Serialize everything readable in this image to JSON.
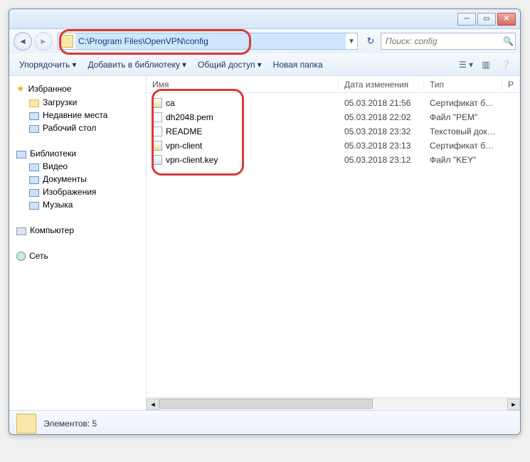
{
  "address_bar": {
    "path": "C:\\Program Files\\OpenVPN\\config"
  },
  "search": {
    "placeholder": "Поиск: config"
  },
  "toolbar": {
    "organize": "Упорядочить",
    "library": "Добавить в библиотеку",
    "share": "Общий доступ",
    "new_folder": "Новая папка"
  },
  "sidebar": {
    "favorites": {
      "title": "Избранное",
      "items": [
        "Загрузки",
        "Недавние места",
        "Рабочий стол"
      ]
    },
    "libraries": {
      "title": "Библиотеки",
      "items": [
        "Видео",
        "Документы",
        "Изображения",
        "Музыка"
      ]
    },
    "computer": {
      "title": "Компьютер"
    },
    "network": {
      "title": "Сеть"
    }
  },
  "columns": {
    "name": "Имя",
    "date": "Дата изменения",
    "type": "Тип",
    "size": "Р"
  },
  "files": [
    {
      "name": "ca",
      "date": "05.03.2018 21:56",
      "type": "Сертификат безо…",
      "icon": "cert"
    },
    {
      "name": "dh2048.pem",
      "date": "05.03.2018 22:02",
      "type": "Файл \"PEM\"",
      "icon": "file"
    },
    {
      "name": "README",
      "date": "05.03.2018 23:32",
      "type": "Текстовый докум…",
      "icon": "file"
    },
    {
      "name": "vpn-client",
      "date": "05.03.2018 23:13",
      "type": "Сертификат безо…",
      "icon": "cert"
    },
    {
      "name": "vpn-client.key",
      "date": "05.03.2018 23:12",
      "type": "Файл \"KEY\"",
      "icon": "key"
    }
  ],
  "status": {
    "elements_label": "Элементов: 5"
  }
}
